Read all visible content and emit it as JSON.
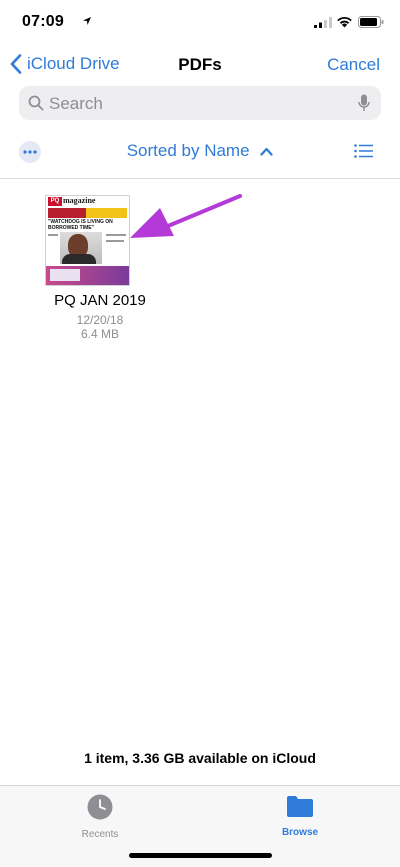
{
  "status_bar": {
    "time": "07:09",
    "icons": [
      "location-arrow-icon",
      "signal-icon",
      "wifi-icon",
      "battery-icon"
    ]
  },
  "nav": {
    "back_label": "iCloud Drive",
    "title": "PDFs",
    "cancel_label": "Cancel"
  },
  "search": {
    "placeholder": "Search"
  },
  "toolbar": {
    "sort_label": "Sorted by Name",
    "more_icon": "ellipsis-icon",
    "list_icon": "list-view-icon"
  },
  "files": [
    {
      "name": "PQ JAN 2019",
      "date": "12/20/18",
      "size": "6.4 MB",
      "thumbnail": {
        "masthead_pq": "PQ",
        "masthead_name": "magazine",
        "headline": "\"WATCHDOG IS LIVING ON BORROWED TIME\""
      }
    }
  ],
  "footer": {
    "summary": "1 item, 3.36 GB available on iCloud"
  },
  "tabs": [
    {
      "label": "Recents",
      "icon": "clock-icon",
      "active": false
    },
    {
      "label": "Browse",
      "icon": "folder-icon",
      "active": true
    }
  ],
  "colors": {
    "accent": "#2f7bd9",
    "annotation_arrow": "#b43ad8"
  }
}
